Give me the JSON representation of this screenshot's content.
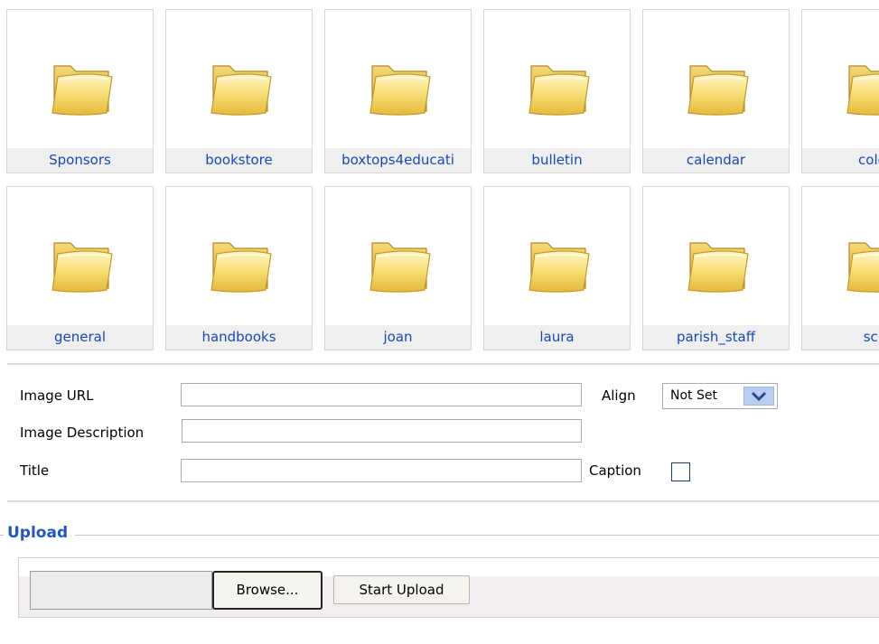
{
  "folders": [
    {
      "label": "Sponsors"
    },
    {
      "label": "bookstore"
    },
    {
      "label": "boxtops4educati"
    },
    {
      "label": "bulletin"
    },
    {
      "label": "calendar"
    },
    {
      "label": "color"
    },
    {
      "label": "general"
    },
    {
      "label": "handbooks"
    },
    {
      "label": "joan"
    },
    {
      "label": "laura"
    },
    {
      "label": "parish_staff"
    },
    {
      "label": "sch"
    }
  ],
  "form": {
    "image_url_label": "Image URL",
    "image_url_value": "",
    "align_label": "Align",
    "align_value": "Not Set",
    "description_label": "Image Description",
    "description_value": "",
    "title_label": "Title",
    "title_value": "",
    "caption_label": "Caption",
    "caption_checked": false
  },
  "upload": {
    "legend": "Upload",
    "browse_label": "Browse...",
    "start_label": "Start Upload"
  },
  "colors": {
    "link_blue": "#1a47b8",
    "legend_blue": "#1f57c3",
    "folder_yellow": "#f4d75e"
  }
}
